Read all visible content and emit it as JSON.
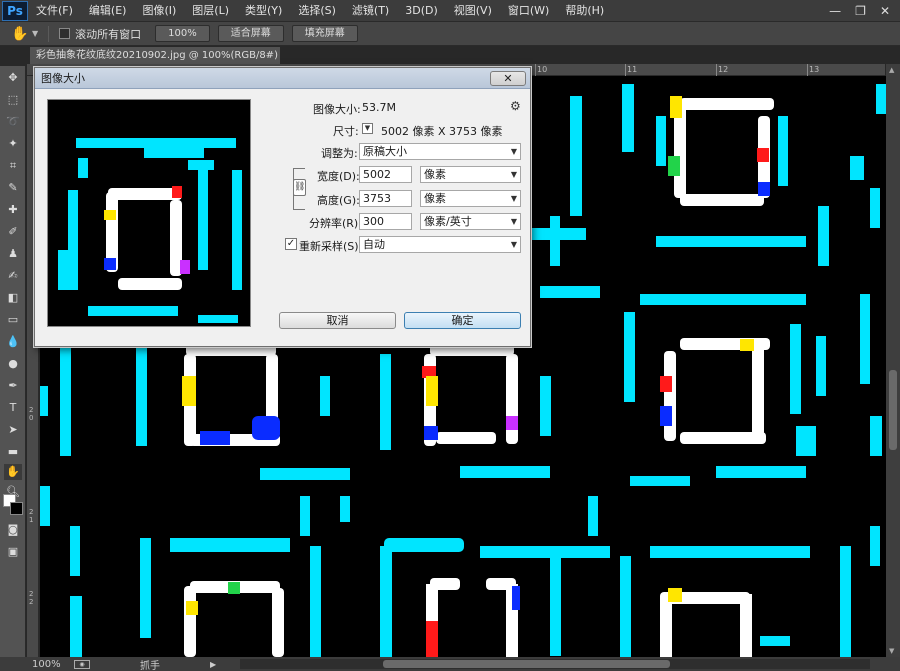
{
  "app": {
    "logo": "Ps"
  },
  "menu": [
    "文件(F)",
    "编辑(E)",
    "图像(I)",
    "图层(L)",
    "类型(Y)",
    "选择(S)",
    "滤镜(T)",
    "3D(D)",
    "视图(V)",
    "窗口(W)",
    "帮助(H)"
  ],
  "window_controls": {
    "minimize": "—",
    "restore": "❐",
    "close": "✕"
  },
  "options_bar": {
    "tool_icon": "hand-icon",
    "scroll_all_label": "滚动所有窗口",
    "scroll_all_checked": false,
    "btn_100": "100%",
    "btn_fit": "适合屏幕",
    "btn_fill": "填充屏幕"
  },
  "document_tab": "彩色抽象花纹底纹20210902.jpg @ 100%(RGB/8#)",
  "ruler": {
    "top_marks": [
      "10",
      "11",
      "12",
      "13"
    ],
    "left_marks": [
      "2\n0",
      "2\n1",
      "2\n2"
    ]
  },
  "status": {
    "zoom": "100%",
    "tool": "抓手"
  },
  "dialog": {
    "title": "图像大小",
    "close": "✕",
    "image_size_label": "图像大小:",
    "image_size_value": "53.7M",
    "dimensions_label": "尺寸:",
    "dimensions_value": "5002 像素  X  3753 像素",
    "fit_to_label": "调整为:",
    "fit_to_value": "原稿大小",
    "width_label": "宽度(D):",
    "width_value": "5002",
    "width_unit": "像素",
    "height_label": "高度(G):",
    "height_value": "3753",
    "height_unit": "像素",
    "resolution_label": "分辨率(R):",
    "resolution_value": "300",
    "resolution_unit": "像素/英寸",
    "resample_label": "重新采样(S):",
    "resample_checked": true,
    "resample_value": "自动",
    "cancel": "取消",
    "ok": "确定"
  },
  "colors": {
    "cyan": "#00e5ff",
    "white": "#ffffff",
    "blue": "#0a2cff",
    "red": "#ff1a1a",
    "yellow": "#ffe600",
    "green": "#22d34a",
    "magenta": "#c930ff",
    "ui_dark": "#3c3c3c",
    "dialog_bg": "#f0f0f0"
  }
}
